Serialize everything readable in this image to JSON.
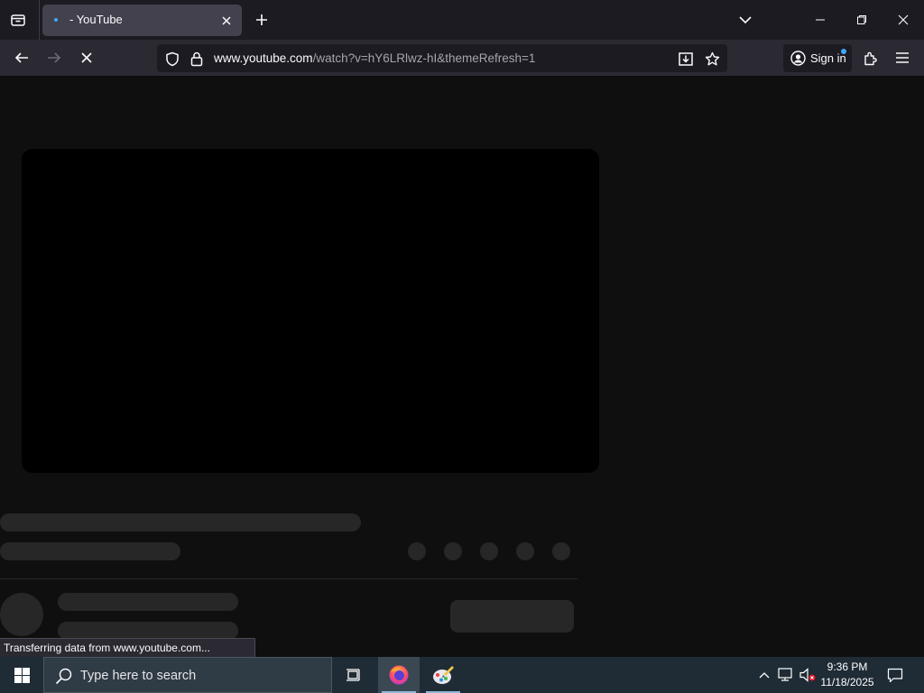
{
  "browser": {
    "tab": {
      "title": "- YouTube"
    },
    "url": {
      "host": "www.youtube.com",
      "path": "/watch?v=hY6LRlwz-hI&themeRefresh=1"
    },
    "signin_label": "Sign in",
    "status_text": "Transferring data from www.youtube.com..."
  },
  "page": {
    "state": "loading skeleton"
  },
  "taskbar": {
    "search_placeholder": "Type here to search",
    "time": "9:36 PM",
    "date": "11/18/2025"
  },
  "colors": {
    "accent_dot": "#3ea8ff",
    "skeleton": "#272727",
    "page_bg": "#0f0f0f"
  },
  "icons": [
    "list-all-tabs-icon",
    "youtube-favicon",
    "close-tab-icon",
    "new-tab-icon",
    "tab-list-chevron-icon",
    "minimize-icon",
    "restore-icon",
    "window-close-icon",
    "back-icon",
    "forward-icon",
    "stop-loading-icon",
    "tracking-protection-shield-icon",
    "lock-icon",
    "install-app-icon",
    "bookmark-star-icon",
    "account-icon",
    "extensions-icon",
    "app-menu-icon",
    "windows-start-icon",
    "search-icon",
    "task-view-icon",
    "firefox-icon",
    "paint-icon",
    "show-hidden-icons-chevron",
    "network-icon",
    "volume-muted-icon",
    "notifications-icon"
  ]
}
